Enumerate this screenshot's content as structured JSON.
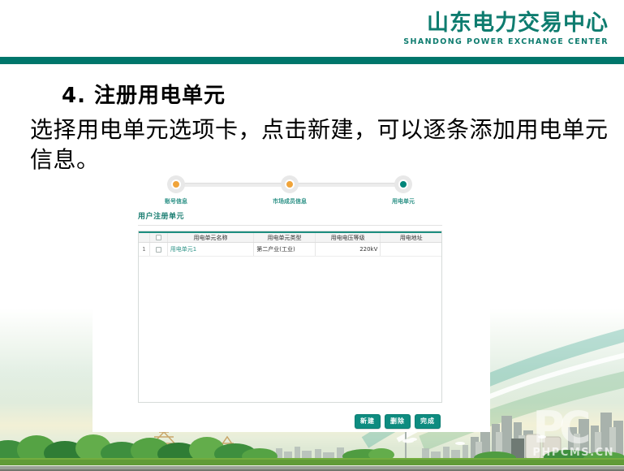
{
  "brand": {
    "name_cn": "山东电力交易中心",
    "name_en": "SHANDONG POWER EXCHANGE CENTER"
  },
  "slide": {
    "title": "4. 注册用电单元",
    "body": "选择用电单元选项卡，点击新建，可以逐条添加用电单元信息。"
  },
  "registration_app": {
    "steps": [
      {
        "label": "账号信息",
        "state": "done"
      },
      {
        "label": "市场成员信息",
        "state": "done"
      },
      {
        "label": "用电单元",
        "state": "current"
      }
    ],
    "section_title": "用户注册单元",
    "table": {
      "columns": [
        "用电单元名称",
        "用电单元类型",
        "用电电压等级",
        "用电地址"
      ],
      "rows": [
        {
          "index": "1",
          "name": "用电单元1",
          "type": "第二产业(工业)",
          "voltage": "220kV",
          "address": ""
        }
      ]
    },
    "buttons": [
      {
        "label": "新建"
      },
      {
        "label": "删除"
      },
      {
        "label": "完成"
      }
    ]
  },
  "watermark": {
    "logo": "PC",
    "text": "PHPCMS.CN"
  },
  "colors": {
    "brand_teal": "#0e7c6f",
    "bar_teal": "#00766b",
    "step_orange": "#f0a43a",
    "step_teal": "#00857a",
    "button_teal": "#0e8c80",
    "link_teal": "#2f9488"
  }
}
